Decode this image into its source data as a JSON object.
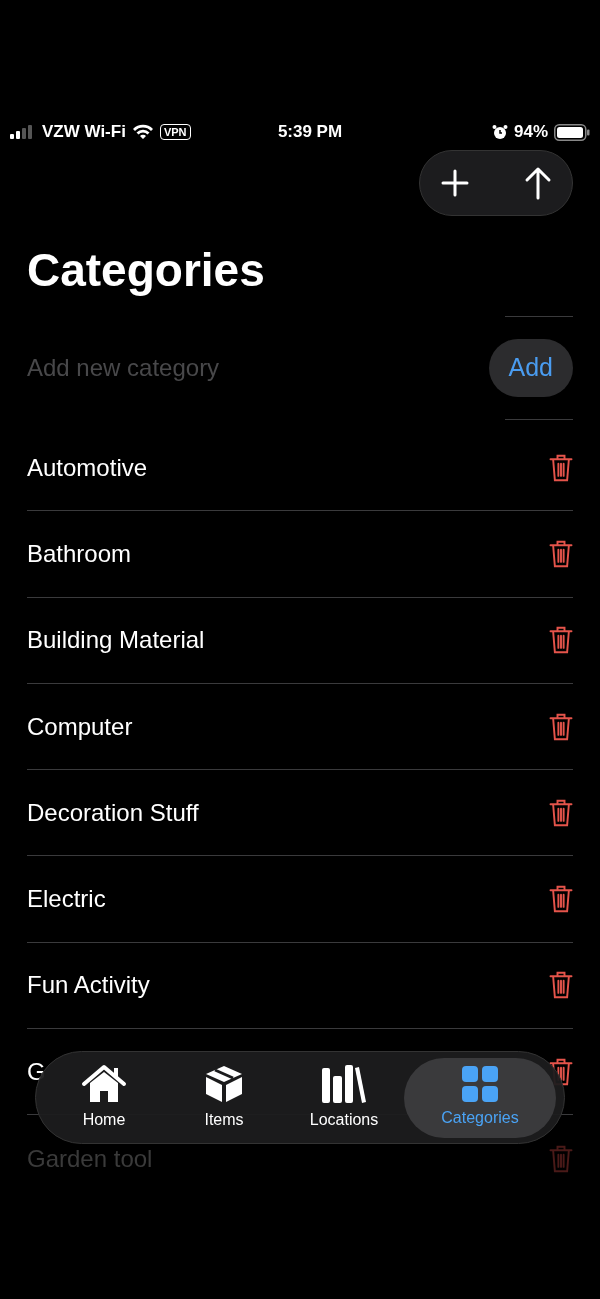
{
  "status_bar": {
    "carrier": "VZW Wi-Fi",
    "vpn": "VPN",
    "time": "5:39 PM",
    "battery": "94%"
  },
  "title": "Categories",
  "new_category": {
    "placeholder": "Add new category",
    "button": "Add"
  },
  "categories": [
    {
      "name": "Automotive",
      "dimmed": false
    },
    {
      "name": "Bathroom",
      "dimmed": false
    },
    {
      "name": "Building Material",
      "dimmed": false
    },
    {
      "name": "Computer",
      "dimmed": false
    },
    {
      "name": "Decoration Stuff",
      "dimmed": false
    },
    {
      "name": "Electric",
      "dimmed": false
    },
    {
      "name": "Fun Activity",
      "dimmed": false
    },
    {
      "name": "G",
      "dimmed": false
    },
    {
      "name": "Garden tool",
      "dimmed": true
    }
  ],
  "tab_bar": [
    {
      "label": "Home",
      "kind": "home",
      "selected": false
    },
    {
      "label": "Items",
      "kind": "items",
      "selected": false
    },
    {
      "label": "Locations",
      "kind": "locations",
      "selected": false
    },
    {
      "label": "Categories",
      "kind": "categories",
      "selected": true
    }
  ]
}
